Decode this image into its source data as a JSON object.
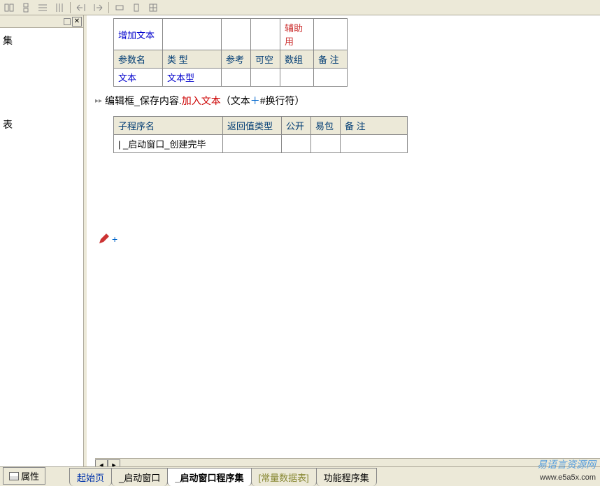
{
  "toolbar": {
    "icons": [
      "align-left",
      "align-center",
      "align-full",
      "align-dist",
      "indent-left",
      "indent-right",
      "grid-h",
      "grid-v",
      "grid-both"
    ]
  },
  "left_panel": {
    "text1": "集",
    "text2": "表"
  },
  "table1": {
    "r1": [
      "增加文本",
      "",
      "",
      "",
      "辅助用",
      ""
    ],
    "h": [
      "参数名",
      "类 型",
      "参考",
      "可空",
      "数组",
      "备 注"
    ],
    "r2": [
      "文本",
      "文本型",
      "",
      "",
      "",
      ""
    ]
  },
  "code_line": {
    "part1": "编辑框_保存内容.",
    "part2": "加入文本",
    "part3": "（文本 ",
    "plus": "＋",
    "part4": " #换行符）"
  },
  "table2": {
    "h": [
      "子程序名",
      "返回值类型",
      "公开",
      "易包",
      "备 注"
    ],
    "r1": [
      "_启动窗口_创建完毕",
      "",
      "",
      "",
      ""
    ]
  },
  "bottom": {
    "properties": "属性"
  },
  "tabs": {
    "t1": "起始页",
    "t2": "_启动窗口",
    "t3": "_启动窗口程序集",
    "t4": "[常量数据表]",
    "t5": "功能程序集"
  },
  "watermark": {
    "zh": "易语言资源网",
    "url": "www.e5a5x.com"
  }
}
